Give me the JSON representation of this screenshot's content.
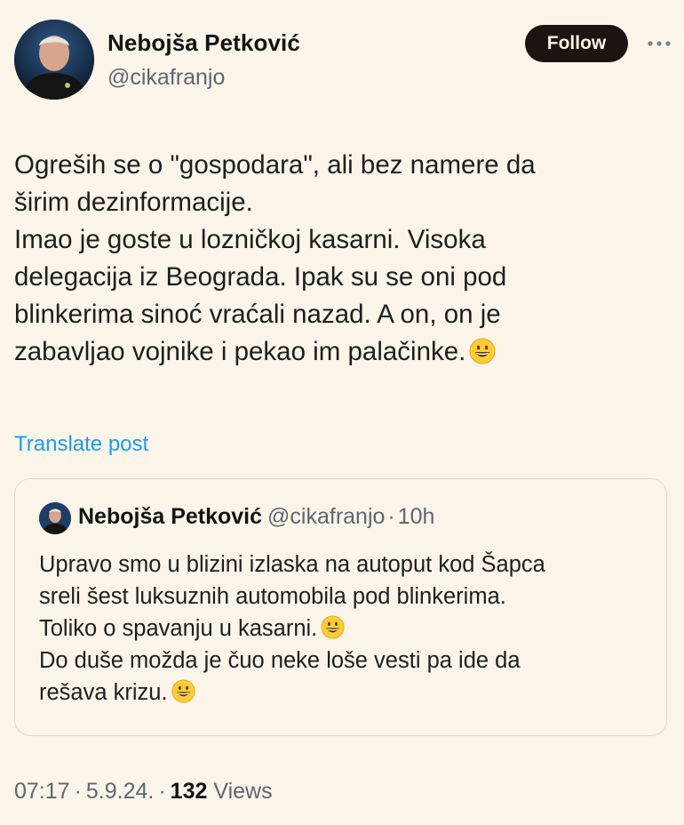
{
  "author": {
    "display_name": "Nebojša Petković",
    "handle": "@cikafranjo"
  },
  "follow_label": "Follow",
  "post": {
    "lines": [
      "Ogreših se o \"gospodara\", ali bez namere da",
      "širim dezinformacije.",
      "Imao je goste u lozničkoj kasarni. Visoka",
      "delegacija iz Beograda. Ipak su se oni pod",
      "blinkerima sinoć vraćali nazad. A on, on je",
      "zabavljao vojnike i pekao im palačinke."
    ]
  },
  "translate_label": "Translate post",
  "quote": {
    "display_name": "Nebojša Petković",
    "handle": "@cikafranjo",
    "separator": "·",
    "time": "10h",
    "lines": [
      "Upravo smo u blizini izlaska na autoput kod Šapca",
      "sreli šest luksuznih automobila pod blinkerima.",
      "Toliko o spavanju u kasarni.",
      "Do duše možda je čuo neke loše vesti pa ide da",
      "rešava krizu."
    ]
  },
  "meta": {
    "time": "07:17",
    "separator": "·",
    "date": "5.9.24.",
    "views_count": "132",
    "views_label": "Views"
  },
  "colors": {
    "background": "#fbf4e9",
    "link": "#1d9bf0",
    "follow_button": "#1b1410",
    "muted": "#5e6670"
  },
  "icons": {
    "emoji": "grinning-face-emoji",
    "more": "more-dots-icon"
  }
}
